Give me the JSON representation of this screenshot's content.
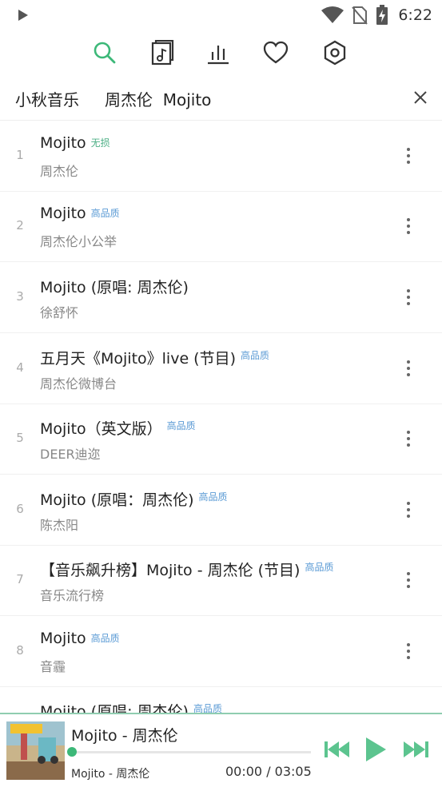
{
  "status_bar": {
    "time": "6:22"
  },
  "header": {
    "app_name": "小秋音乐",
    "query": "周杰伦  Mojito"
  },
  "songs": [
    {
      "num": "1",
      "title": "Mojito",
      "badge": "无损",
      "badge_type": "lossless",
      "artist": "周杰伦"
    },
    {
      "num": "2",
      "title": "Mojito",
      "badge": "高品质",
      "badge_type": "hq",
      "artist": "周杰伦小公举"
    },
    {
      "num": "3",
      "title": "Mojito (原唱: 周杰伦)",
      "badge": "",
      "badge_type": "",
      "artist": "徐舒怀"
    },
    {
      "num": "4",
      "title": "五月天《Mojito》live (节目)",
      "badge": "高品质",
      "badge_type": "hq",
      "artist": "周杰伦微博台"
    },
    {
      "num": "5",
      "title": "Mojito（英文版）",
      "badge": "高品质",
      "badge_type": "hq",
      "artist": "DEER迪迩"
    },
    {
      "num": "6",
      "title": "Mojito (原唱：周杰伦)",
      "badge": "高品质",
      "badge_type": "hq",
      "artist": "陈杰阳"
    },
    {
      "num": "7",
      "title": "【音乐飙升榜】Mojito - 周杰伦 (节目)",
      "badge": "高品质",
      "badge_type": "hq",
      "artist": "音乐流行榜"
    },
    {
      "num": "8",
      "title": "Mojito",
      "badge": "高品质",
      "badge_type": "hq",
      "artist": "音霾"
    },
    {
      "num": "",
      "title": "Mojito (原唱: 周杰伦)",
      "badge": "高品质",
      "badge_type": "hq",
      "artist": ""
    }
  ],
  "player": {
    "title": "Mojito - 周杰伦",
    "subtitle": "Mojito - 周杰伦",
    "time": "00:00 / 03:05",
    "progress": 0.0
  },
  "colors": {
    "accent": "#3cb878",
    "hq_badge": "#5b9bd5",
    "lossless_badge": "#4caf85"
  },
  "icons": {
    "toolbar": [
      "search-icon",
      "music-file-icon",
      "equalizer-icon",
      "heart-icon",
      "settings-icon"
    ],
    "player": [
      "previous-icon",
      "play-icon",
      "next-icon"
    ]
  }
}
